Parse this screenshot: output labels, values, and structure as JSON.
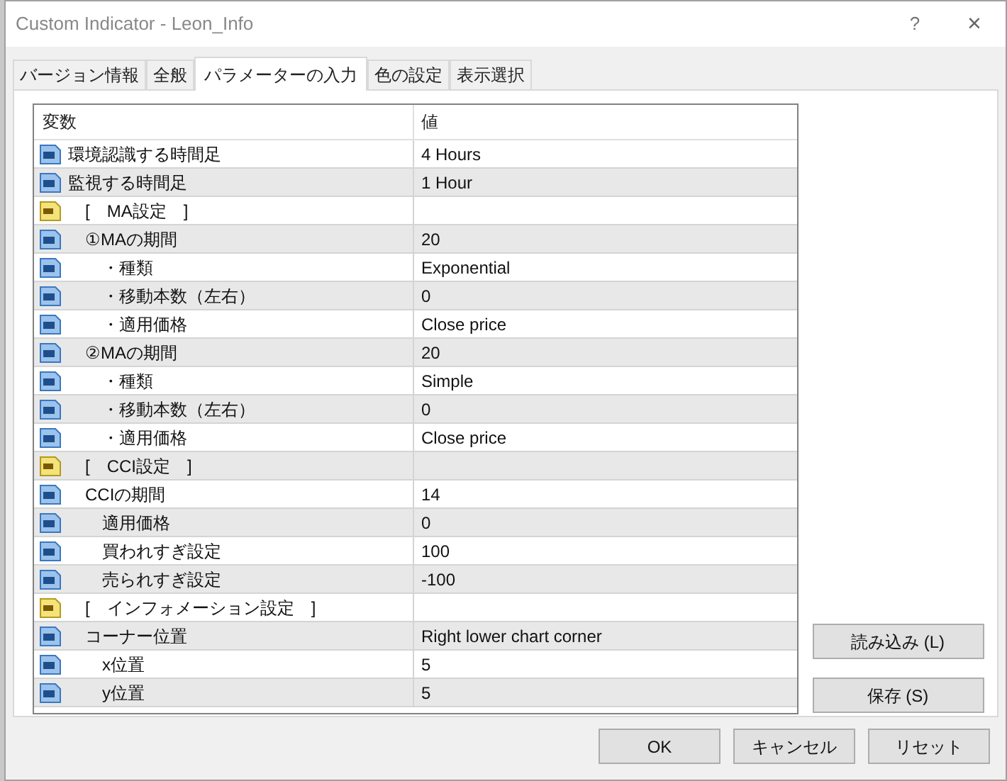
{
  "window": {
    "title": "Custom Indicator - Leon_Info",
    "help": "?",
    "close": "×"
  },
  "tabs": [
    {
      "label": "バージョン情報",
      "selected": false
    },
    {
      "label": "全般",
      "selected": false
    },
    {
      "label": "パラメーターの入力",
      "selected": true
    },
    {
      "label": "色の設定",
      "selected": false
    },
    {
      "label": "表示選択",
      "selected": false
    }
  ],
  "table": {
    "columns": [
      "変数",
      "値"
    ],
    "rows": [
      {
        "kind": "number",
        "name": "環境認識する時間足",
        "value": "4 Hours"
      },
      {
        "kind": "number",
        "name": "監視する時間足",
        "value": "1 Hour"
      },
      {
        "kind": "text",
        "name": "[　MA設定　]",
        "children": [
          {
            "kind": "number",
            "name": "①MAの期間",
            "value": "20",
            "children": [
              {
                "kind": "number",
                "name": "・種類",
                "value": "Exponential"
              },
              {
                "kind": "number",
                "name": "・移動本数（左右）",
                "value": "0"
              },
              {
                "kind": "number",
                "name": "・適用価格",
                "value": "Close price"
              }
            ]
          },
          {
            "kind": "number",
            "name": "②MAの期間",
            "value": "20",
            "children": [
              {
                "kind": "number",
                "name": "・種類",
                "value": "Simple"
              },
              {
                "kind": "number",
                "name": "・移動本数（左右）",
                "value": "0"
              },
              {
                "kind": "number",
                "name": "・適用価格",
                "value": "Close price"
              }
            ]
          }
        ]
      },
      {
        "kind": "text",
        "name": "[　CCI設定　]",
        "children": [
          {
            "kind": "number",
            "name": "CCIの期間",
            "value": "14",
            "children": [
              {
                "kind": "number",
                "name": "適用価格",
                "value": "0"
              },
              {
                "kind": "number",
                "name": "買われすぎ設定",
                "value": "100"
              },
              {
                "kind": "number",
                "name": "売られすぎ設定",
                "value": "-100"
              }
            ]
          }
        ]
      },
      {
        "kind": "text",
        "name": "[　インフォメーション設定　]",
        "children": [
          {
            "kind": "number",
            "name": "コーナー位置",
            "value": "Right lower chart corner",
            "children": [
              {
                "kind": "number",
                "name": "x位置",
                "value": "5"
              },
              {
                "kind": "number",
                "name": "y位置",
                "value": "5"
              }
            ]
          }
        ]
      }
    ]
  },
  "side_buttons": [
    "読み込み (L)",
    "保存 (S)"
  ],
  "buttons": [
    "OK",
    "キャンセル",
    "リセット"
  ]
}
